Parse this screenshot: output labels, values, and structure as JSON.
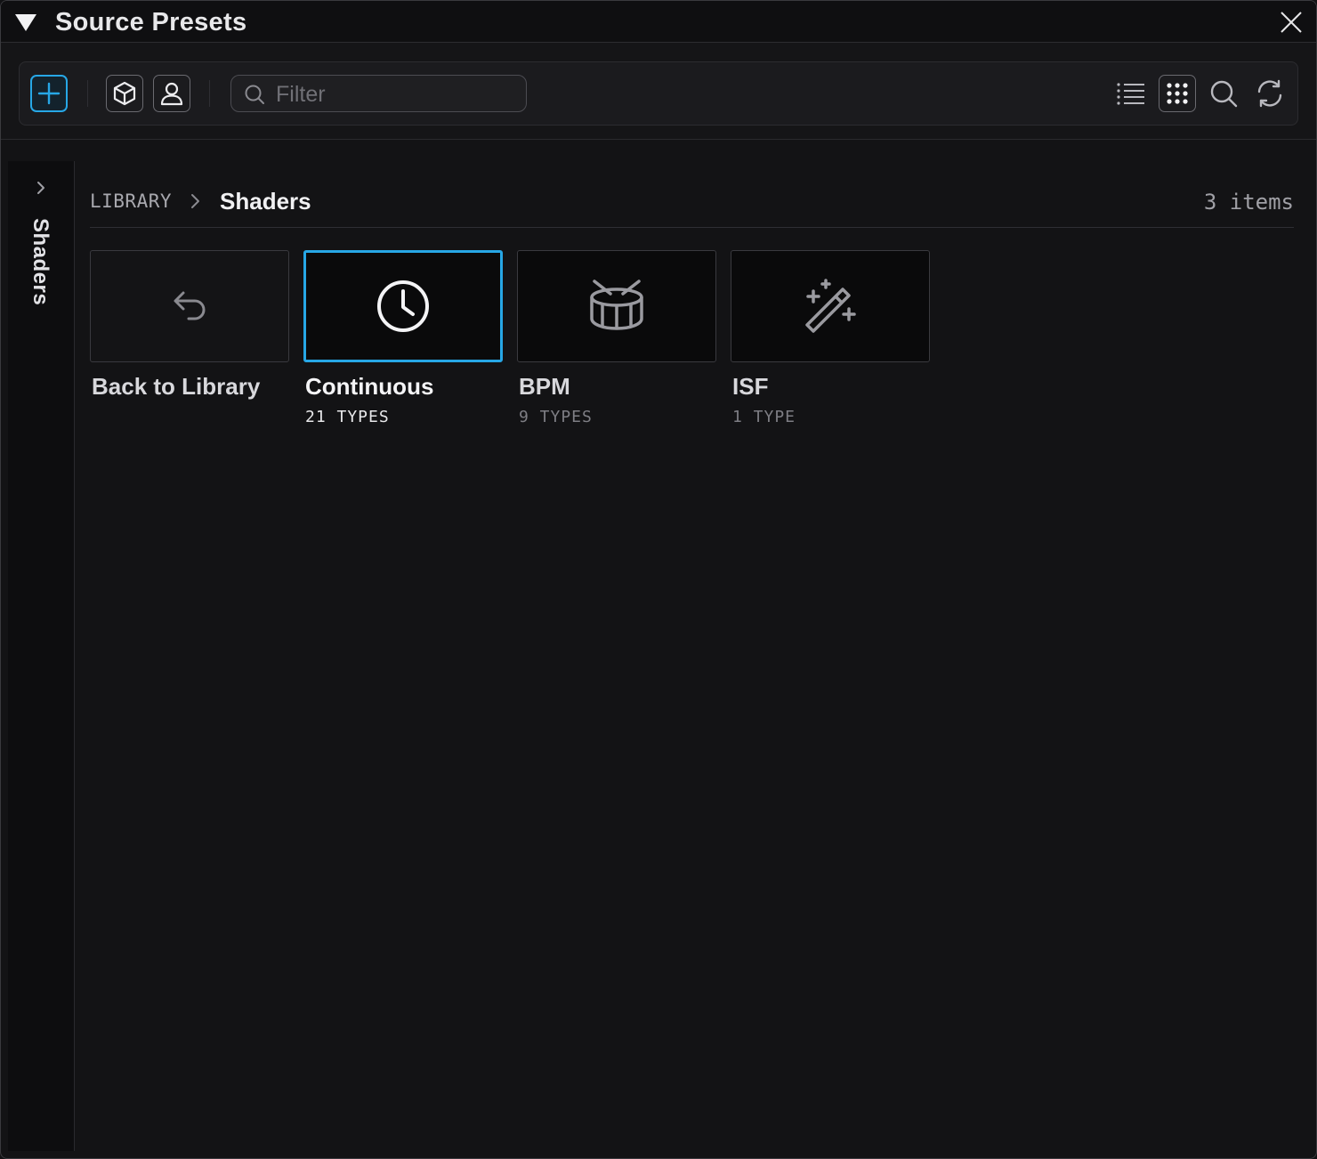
{
  "window": {
    "title": "Source Presets"
  },
  "toolbar": {
    "filter_placeholder": "Filter",
    "filter_value": ""
  },
  "rail": {
    "label": "Shaders"
  },
  "breadcrumb": {
    "root": "LIBRARY",
    "current": "Shaders"
  },
  "item_count": "3 items",
  "tiles": [
    {
      "name": "Back to Library",
      "sub": "",
      "icon": "undo-icon"
    },
    {
      "name": "Continuous",
      "sub": "21 TYPES",
      "icon": "clock-icon",
      "selected": true
    },
    {
      "name": "BPM",
      "sub": "9 TYPES",
      "icon": "drum-icon"
    },
    {
      "name": "ISF",
      "sub": "1 TYPE",
      "icon": "magic-wand-icon"
    }
  ],
  "colors": {
    "accent": "#27a7e6",
    "background": "#131315"
  }
}
